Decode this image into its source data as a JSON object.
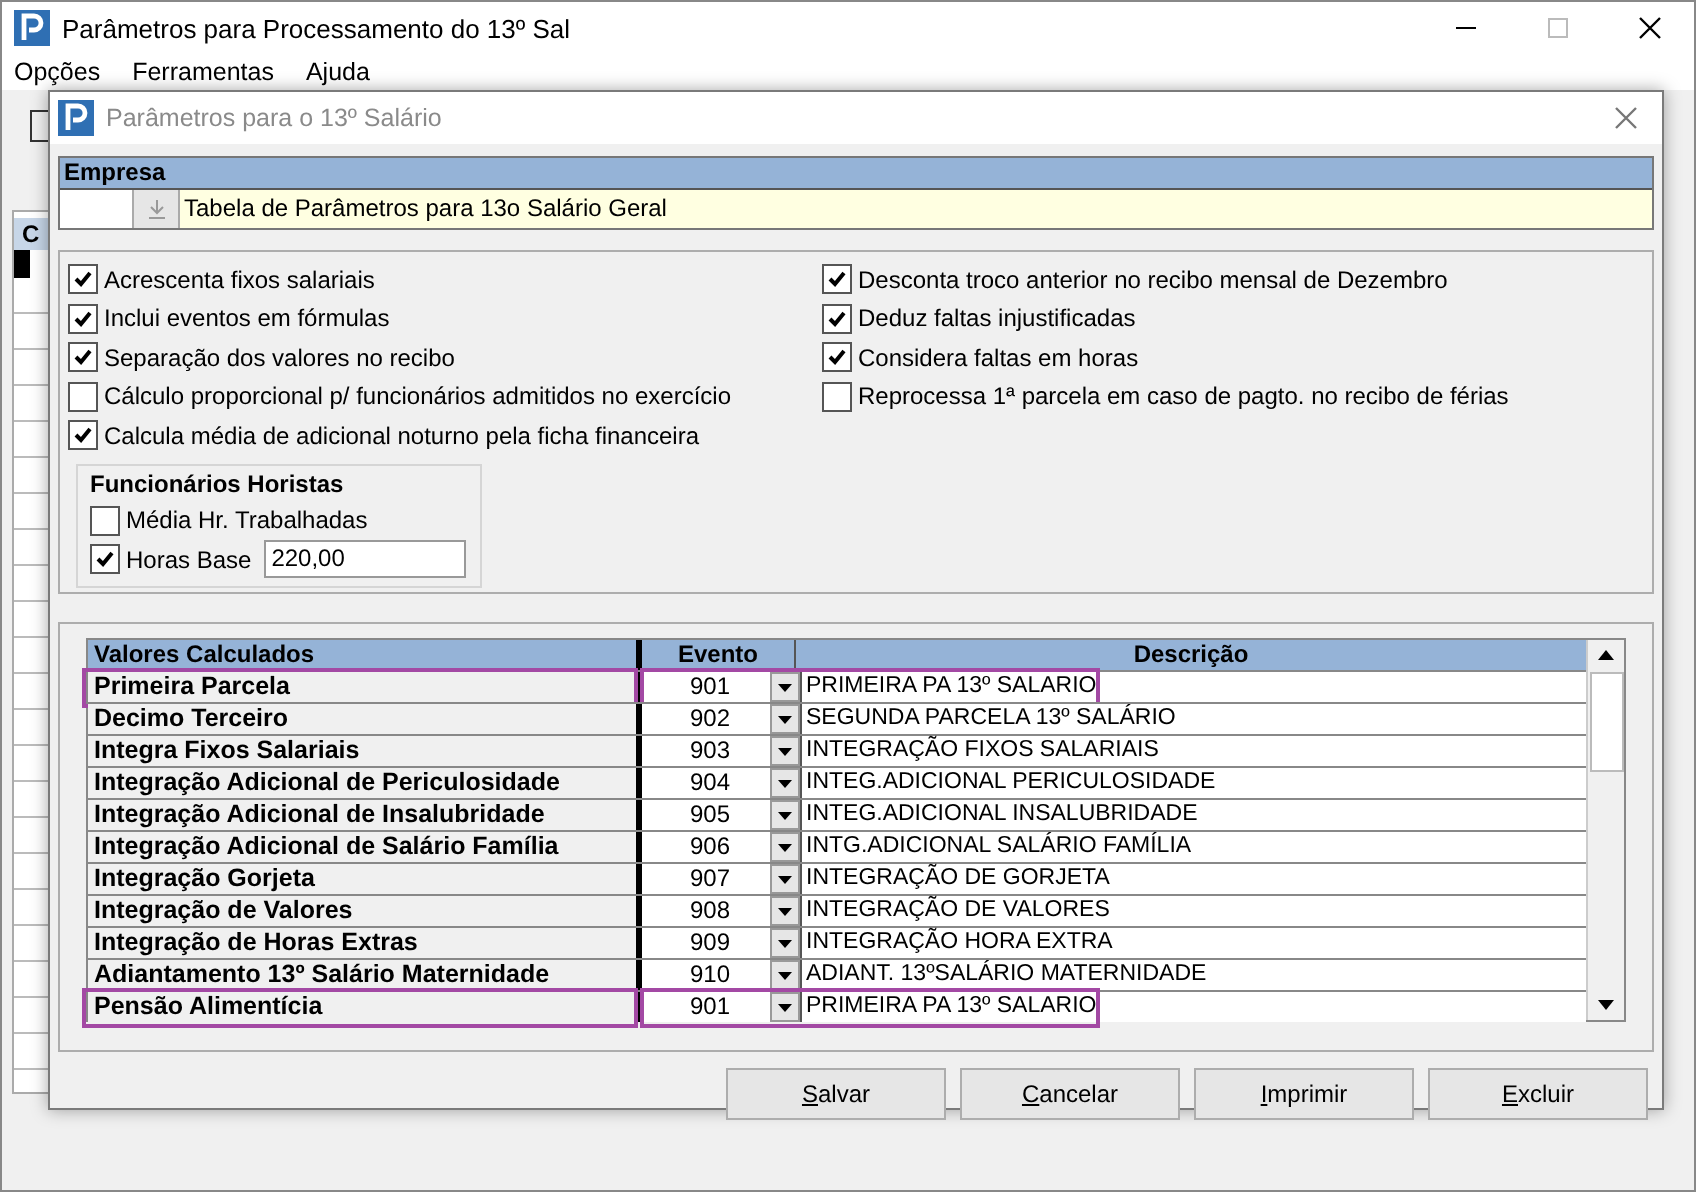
{
  "main_window": {
    "title": "Parâmetros para Processamento do 13º Sal",
    "menu": [
      "Opções",
      "Ferramentas",
      "Ajuda"
    ],
    "grid_header": "C"
  },
  "dialog": {
    "title": "Parâmetros para o 13º Salário"
  },
  "empresa": {
    "label": "Empresa",
    "description": "Tabela de Parâmetros para 13o Salário Geral"
  },
  "options_left": [
    {
      "label": "Acrescenta fixos salariais",
      "checked": true
    },
    {
      "label": "Inclui eventos em fórmulas",
      "checked": true
    },
    {
      "label": "Separação dos valores no recibo",
      "checked": true
    },
    {
      "label": "Cálculo proporcional p/ funcionários admitidos no exercício",
      "checked": false
    },
    {
      "label": "Calcula média de adicional noturno pela ficha financeira",
      "checked": true
    }
  ],
  "options_right": [
    {
      "label": "Desconta troco anterior no recibo mensal de Dezembro",
      "checked": true
    },
    {
      "label": "Deduz faltas injustificadas",
      "checked": true
    },
    {
      "label": "Considera faltas em horas",
      "checked": true
    },
    {
      "label": "Reprocessa 1ª parcela em caso de pagto. no recibo de férias",
      "checked": false
    }
  ],
  "horistas": {
    "title": "Funcionários Horistas",
    "items": [
      {
        "label": "Média Hr. Trabalhadas",
        "checked": false
      },
      {
        "label": "Horas Base",
        "checked": true,
        "value": "220,00"
      }
    ]
  },
  "table": {
    "columns": [
      "Valores Calculados",
      "Evento",
      "Descrição"
    ],
    "rows": [
      {
        "name": "Primeira Parcela",
        "evento": "901",
        "descricao": "PRIMEIRA PA 13º SALARIO",
        "highlighted": true
      },
      {
        "name": "Decimo Terceiro",
        "evento": "902",
        "descricao": "SEGUNDA PARCELA 13º SALÁRIO",
        "highlighted": false
      },
      {
        "name": "Integra Fixos Salariais",
        "evento": "903",
        "descricao": "INTEGRAÇÃO FIXOS SALARIAIS",
        "highlighted": false
      },
      {
        "name": "Integração Adicional de Periculosidade",
        "evento": "904",
        "descricao": "INTEG.ADICIONAL PERICULOSIDADE",
        "highlighted": false
      },
      {
        "name": "Integração Adicional de Insalubridade",
        "evento": "905",
        "descricao": "INTEG.ADICIONAL INSALUBRIDADE",
        "highlighted": false
      },
      {
        "name": "Integração Adicional de Salário Família",
        "evento": "906",
        "descricao": "INTG.ADICIONAL SALÁRIO FAMÍLIA",
        "highlighted": false
      },
      {
        "name": "Integração Gorjeta",
        "evento": "907",
        "descricao": "INTEGRAÇÃO DE GORJETA",
        "highlighted": false
      },
      {
        "name": "Integração de Valores",
        "evento": "908",
        "descricao": "INTEGRAÇÃO DE VALORES",
        "highlighted": false
      },
      {
        "name": "Integração de Horas Extras",
        "evento": "909",
        "descricao": "INTEGRAÇÃO HORA EXTRA",
        "highlighted": false
      },
      {
        "name": "Adiantamento 13º Salário Maternidade",
        "evento": "910",
        "descricao": "ADIANT. 13ºSALÁRIO MATERNIDADE",
        "highlighted": false
      },
      {
        "name": "Pensão Alimentícia",
        "evento": "901",
        "descricao": "PRIMEIRA PA 13º SALARIO",
        "highlighted": true
      }
    ]
  },
  "buttons": [
    "Salvar",
    "Cancelar",
    "Imprimir",
    "Excluir"
  ]
}
